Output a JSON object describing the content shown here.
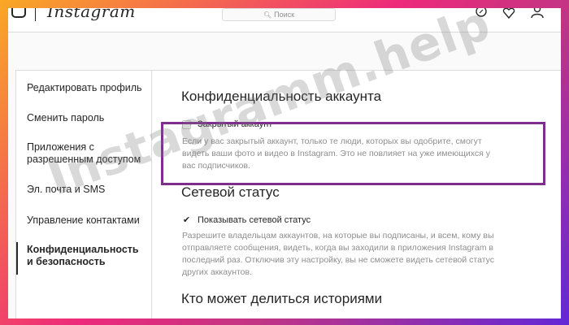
{
  "brand": {
    "name": "Instagram"
  },
  "search": {
    "placeholder": "Поиск",
    "icon": "search-icon"
  },
  "nav_icons": [
    "compass-icon",
    "heart-icon",
    "profile-icon"
  ],
  "sidebar": {
    "items": [
      {
        "label": "Редактировать профиль"
      },
      {
        "label": "Сменить пароль"
      },
      {
        "label": "Приложения с разрешенным доступом"
      },
      {
        "label": "Эл. почта и SMS"
      },
      {
        "label": "Управление контактами"
      },
      {
        "label": "Конфиденциальность и безопасность",
        "active": true
      }
    ]
  },
  "privacy": {
    "title": "Конфиденциальность аккаунта",
    "private_label": "Закрытый аккаунт",
    "private_checked": false,
    "private_desc": "Если у вас закрытый аккаунт, только те люди, которых вы одобрите, смогут видеть ваши фото и видео в Instagram. Это не повлияет на уже имеющихся у вас подписчиков."
  },
  "activity": {
    "title": "Сетевой статус",
    "label": "Показывать сетевой статус",
    "checked": true,
    "desc": "Разрешите владельцам аккаунтов, на которые вы подписаны, и всем, кому вы отправляете сообщения, видеть, когда вы заходили в приложения Instagram в последний раз. Отключив эту настройку, вы не сможете видеть сетевой статус других аккаунтов."
  },
  "stories": {
    "title": "Кто может делиться историями"
  },
  "watermark": "Instagramm.help",
  "colors": {
    "highlight": "#7e2f8e",
    "frame_start": "#f9a825",
    "frame_end": "#6228d7"
  }
}
